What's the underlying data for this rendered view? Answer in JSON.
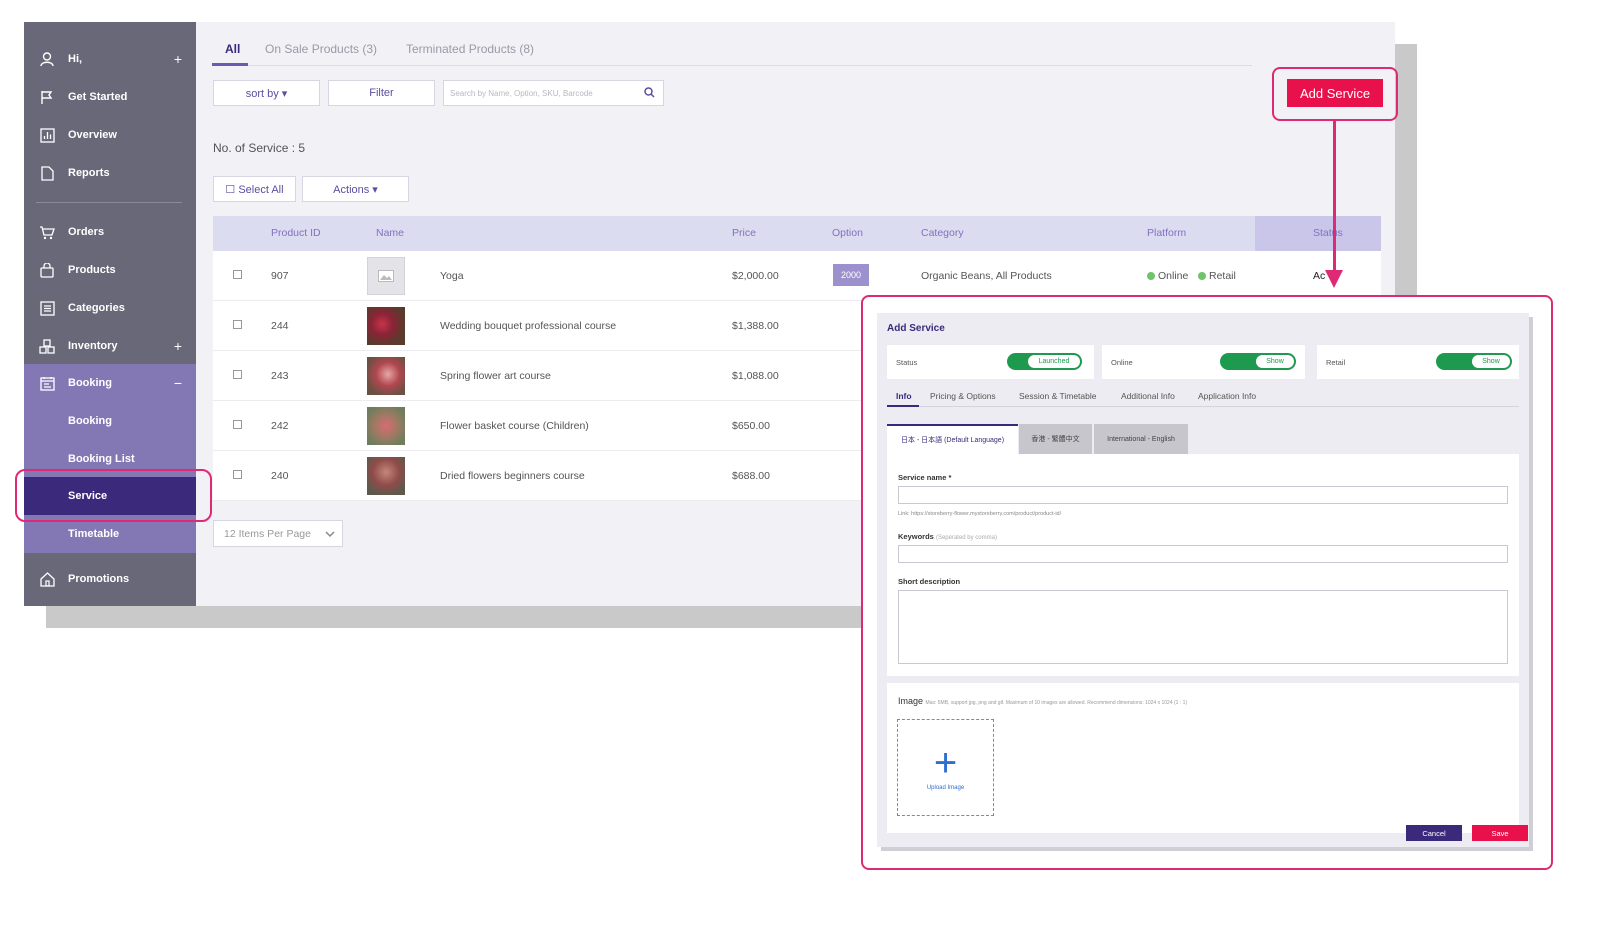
{
  "sidebar": {
    "items": [
      {
        "label": "Hi,",
        "icon": "user-icon",
        "plus": "+"
      },
      {
        "label": "Get Started",
        "icon": "flag-icon"
      },
      {
        "label": "Overview",
        "icon": "chart-icon"
      },
      {
        "label": "Reports",
        "icon": "document-icon"
      },
      {
        "label": "Orders",
        "icon": "cart-icon"
      },
      {
        "label": "Products",
        "icon": "bag-icon"
      },
      {
        "label": "Categories",
        "icon": "list-icon"
      },
      {
        "label": "Inventory",
        "icon": "boxes-icon",
        "plus": "+"
      },
      {
        "label": "Booking",
        "icon": "calendar-icon",
        "minus": "−"
      },
      {
        "label": "Booking"
      },
      {
        "label": "Booking List"
      },
      {
        "label": "Service"
      },
      {
        "label": "Timetable"
      },
      {
        "label": "Promotions",
        "icon": "home-icon"
      }
    ]
  },
  "tabs": [
    {
      "label": "All"
    },
    {
      "label": "On Sale Products (3)"
    },
    {
      "label": "Terminated Products (8)"
    }
  ],
  "toolbar": {
    "sort_label": "sort by ▾",
    "filter_label": "Filter",
    "search_placeholder": "Search by Name, Option, SKU, Barcode",
    "add_service_label": "Add Service"
  },
  "count_label": "No. of Service : 5",
  "select_all_label": "☐ Select All",
  "actions_label": "Actions ▾",
  "table": {
    "headers": [
      "Product ID",
      "Name",
      "Price",
      "Option",
      "Category",
      "Platform",
      "Status"
    ],
    "rows": [
      {
        "id": "907",
        "name": "Yoga",
        "price": "$2,000.00",
        "option": "2000",
        "category": "Organic Beans, All Products",
        "online": "Online",
        "retail": "Retail",
        "status": "Ac"
      },
      {
        "id": "244",
        "name": "Wedding bouquet professional course",
        "price": "$1,388.00"
      },
      {
        "id": "243",
        "name": "Spring flower art course",
        "price": "$1,088.00"
      },
      {
        "id": "242",
        "name": "Flower basket course (Children)",
        "price": "$650.00"
      },
      {
        "id": "240",
        "name": "Dried flowers beginners course",
        "price": "$688.00"
      }
    ]
  },
  "per_page": "12 Items Per Page",
  "modal": {
    "title": "Add Service",
    "status_label": "Status",
    "status_value": "Launched",
    "online_label": "Online",
    "online_value": "Show",
    "retail_label": "Retail",
    "retail_value": "Show",
    "tabs": [
      "Info",
      "Pricing & Options",
      "Session & Timetable",
      "Additional Info",
      "Application Info"
    ],
    "lang_tabs": [
      "日本 - 日本語 (Default Language)",
      "香港 - 繁體中文",
      "International - English"
    ],
    "service_name_label": "Service name *",
    "link_text": "Link: https://storeberry-flower.mystoreberry.com/product/product-id/",
    "keywords_label": "Keywords",
    "keywords_hint": "(Seperated by comma)",
    "short_desc_label": "Short description",
    "image_label": "Image",
    "image_hint": "Max: 5MB, support jpg, png and gif. Maximum of 10 images are allowed. Recommend dimensions: 1024 x 1024 (1 : 1)",
    "upload_label": "Upload Image",
    "cancel_label": "Cancel",
    "save_label": "Save"
  },
  "colors": {
    "accent": "#3b2a7c",
    "brand_red": "#e8114b",
    "highlight": "#de2a75",
    "toggle_green": "#1d9a4e"
  }
}
